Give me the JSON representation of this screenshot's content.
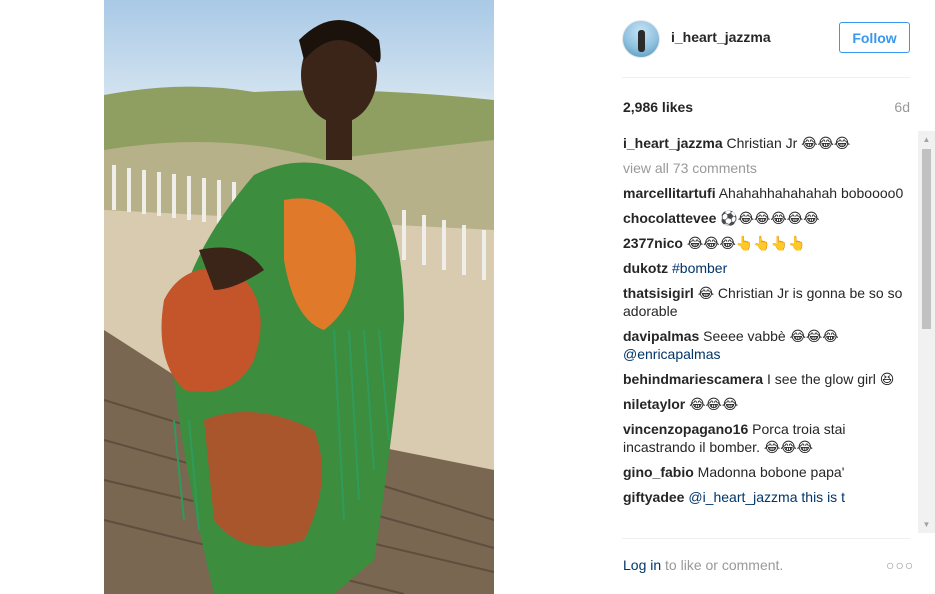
{
  "post": {
    "username": "i_heart_jazzma",
    "follow_label": "Follow",
    "likes": "2,986 likes",
    "age": "6d",
    "caption": {
      "user": "i_heart_jazzma",
      "text": "Christian Jr 😂😂😂"
    },
    "view_all": "view all 73 comments",
    "comments": [
      {
        "user": "marcellitartufi",
        "text": "Ahahahhahahahah boboooo0"
      },
      {
        "user": "chocolattevee",
        "text": "⚽😂😂😂😂😂"
      },
      {
        "user": "2377nico",
        "text": "😂😂😂👆👆👆👆"
      },
      {
        "user": "dukotz",
        "text": "",
        "link": "#bomber"
      },
      {
        "user": "thatsisigirl",
        "text": "😂 Christian Jr is gonna be so so adorable"
      },
      {
        "user": "davipalmas",
        "text": "Seeee vabbè 😂😂😂",
        "link": "@enricapalmas"
      },
      {
        "user": "behindmariescamera",
        "text": "I see the glow girl 😆"
      },
      {
        "user": "niletaylor",
        "text": "😂😂😂"
      },
      {
        "user": "vincenzopagano16",
        "text": "Porca troia stai incastrando il bomber. 😂😂😂"
      },
      {
        "user": "gino_fabio",
        "text": "Madonna bobone papa'"
      },
      {
        "user": "giftyadee",
        "text": "",
        "link": "@i_heart_jazzma this is t"
      }
    ],
    "login_link": "Log in",
    "login_text": " to like or comment.",
    "more_options": "○○○"
  },
  "icons": {
    "avatar": "avatar-photo",
    "more": "more-options-icon",
    "scroll_up": "▲",
    "scroll_down": "▼"
  }
}
